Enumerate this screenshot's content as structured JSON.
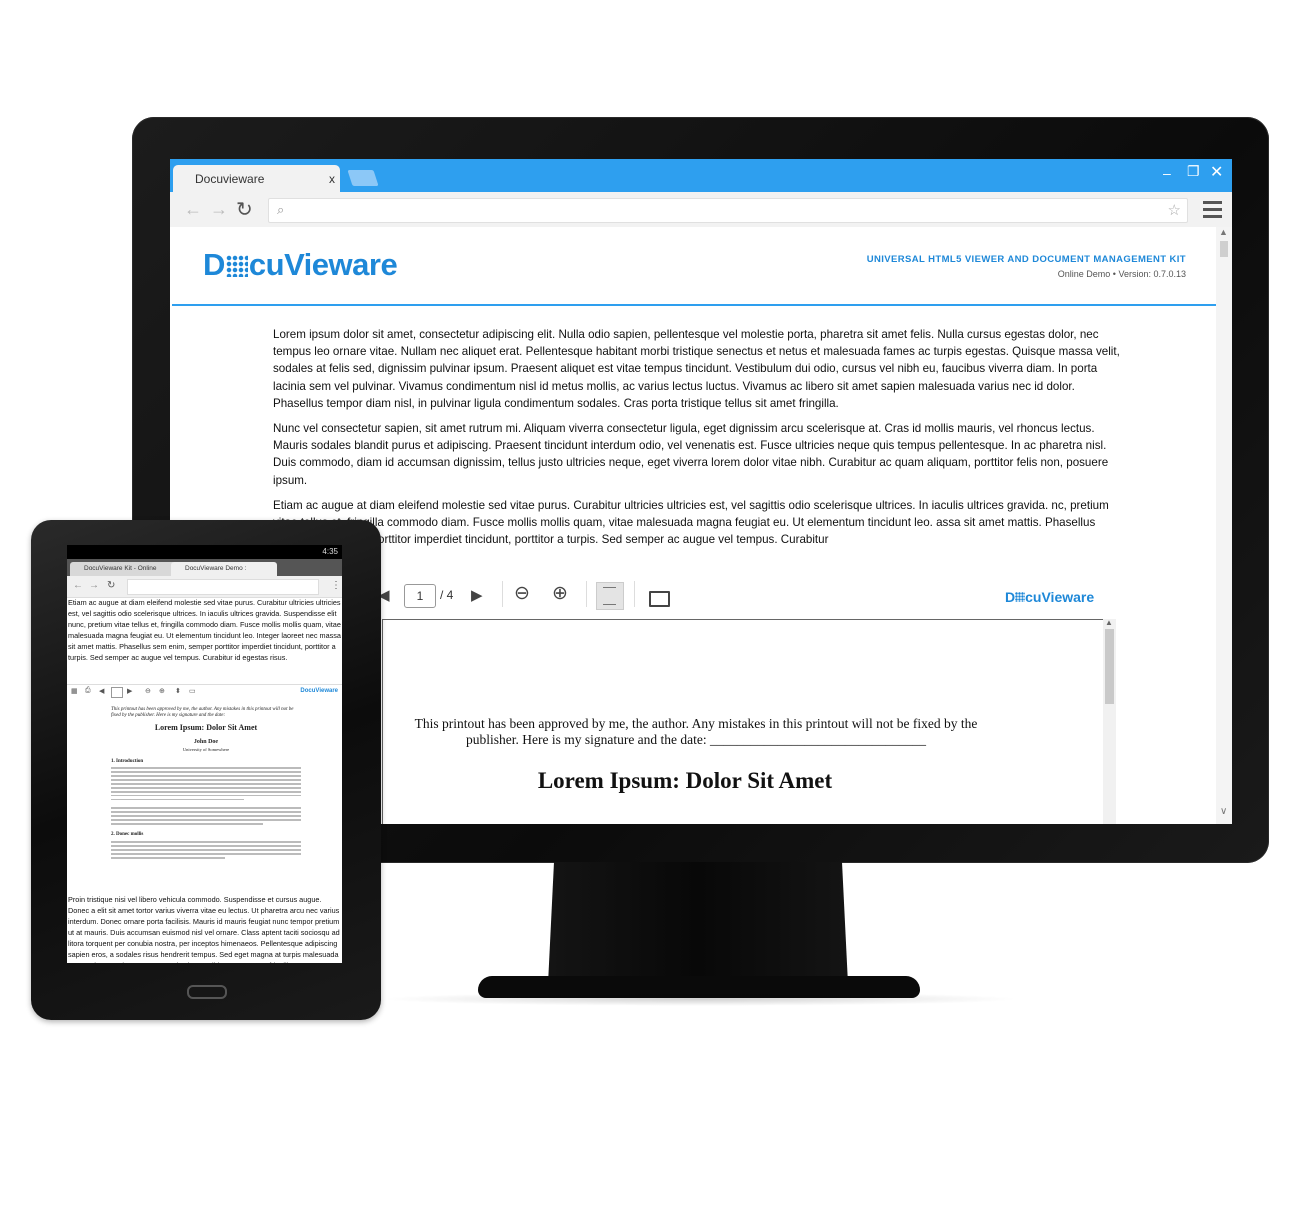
{
  "browser": {
    "tab_title": "Docuvieware",
    "tab_close": "x"
  },
  "header": {
    "brand_prefix": "D",
    "brand_suffix": "cuVieware",
    "tagline": "UNIVERSAL HTML5 VIEWER AND DOCUMENT MANAGEMENT KIT",
    "version": "Online Demo • Version: 0.7.0.13"
  },
  "content": {
    "paragraphs": [
      "Lorem ipsum dolor sit amet, consectetur adipiscing elit. Nulla odio sapien, pellentesque vel molestie porta, pharetra sit amet felis. Nulla cursus egestas dolor, nec tempus leo ornare vitae. Nullam nec aliquet erat. Pellentesque habitant morbi tristique senectus et netus et malesuada fames ac turpis egestas. Quisque massa velit, sodales at felis sed, dignissim pulvinar ipsum. Praesent aliquet est vitae tempus tincidunt. Vestibulum dui odio, cursus vel nibh eu, faucibus viverra diam. In porta lacinia sem vel pulvinar. Vivamus condimentum nisl id metus mollis, ac varius lectus luctus. Vivamus ac libero sit amet sapien malesuada varius nec id dolor. Phasellus tempor diam nisl, in pulvinar ligula condimentum sodales. Cras porta tristique tellus sit amet fringilla.",
      "Nunc vel consectetur sapien, sit amet rutrum mi. Aliquam viverra consectetur ligula, eget dignissim arcu scelerisque at. Cras id mollis mauris, vel rhoncus lectus. Mauris sodales blandit purus et adipiscing. Praesent tincidunt interdum odio, vel venenatis est. Fusce ultricies neque quis tempus pellentesque. In ac pharetra nisl. Duis commodo, diam id accumsan dignissim, tellus justo ultricies neque, eget viverra lorem dolor vitae nibh. Curabitur ac quam aliquam, porttitor felis non, posuere ipsum.",
      "Etiam ac augue at diam eleifend molestie sed vitae purus. Curabitur ultricies ultricies est, vel sagittis odio scelerisque ultrices. In iaculis ultrices gravida. nc, pretium vitae tellus et, fringilla commodo diam. Fusce mollis mollis quam, vitae malesuada magna feugiat eu. Ut elementum tincidunt leo. assa sit amet mattis. Phasellus sem enim, semper porttitor imperdiet tincidunt, porttitor a turpis. Sed semper ac augue vel tempus. Curabitur"
    ]
  },
  "viewer": {
    "page_current": "1",
    "page_total": "/ 4",
    "mini_brand_prefix": "D",
    "mini_brand_suffix": "cuVieware",
    "doc_note": "This printout has been approved by me, the author. Any mistakes in this printout will not be fixed by the publisher. Here is my signature and the date: ________________________________",
    "doc_title": "Lorem Ipsum: Dolor Sit Amet"
  },
  "tablet": {
    "status": "4:35",
    "tab1": "DocuVieware Kit - Online",
    "tab2": "DocuVieware Demo :",
    "top_text": "Etiam ac augue at diam eleifend molestie sed vitae purus. Curabitur ultricies ultricies est, vel sagittis odio scelerisque ultrices. In iaculis ultrices gravida. Suspendisse elit nunc, pretium vitae tellus et, fringilla commodo diam. Fusce mollis mollis quam, vitae malesuada magna feugiat eu. Ut elementum tincidunt leo. Integer laoreet nec massa sit amet mattis. Phasellus sem enim, semper porttitor imperdiet tincidunt, porttitor a turpis. Sed semper ac augue vel tempus. Curabitur id egestas risus.",
    "mini_brand": "DocuVieware",
    "doc_note": "This printout has been approved by me, the author. Any mistakes in this printout will not be fixed by the publisher. Here is my signature and the date:",
    "doc_title": "Lorem Ipsum: Dolor Sit Amet",
    "doc_author": "John Doe",
    "doc_affil": "University of Somewhere",
    "section1": "1. Introduction",
    "section2": "2. Donec mollis",
    "bottom_text": "Proin tristique nisi vel libero vehicula commodo. Suspendisse et cursus augue. Donec a elit sit amet tortor varius viverra vitae eu lectus. Ut pharetra arcu nec varius interdum. Donec ornare porta facilisis. Mauris id mauris feugiat nunc tempor pretium ut at mauris. Duis accumsan euismod nisl vel ornare. Class aptent taciti sociosqu ad litora torquent per conubia nostra, per inceptos himenaeos. Pellentesque adipiscing sapien eros, a sodales risus hendrerit tempus. Sed eget magna at turpis malesuada commodo a non lectus. Donec quis viverra nibh. Cras tempus fringilla magna, nec tempus metus lacinia non. Cras leo tellus, hendrerit nec ipsum id, aliquet congue"
  },
  "colors": {
    "accent": "#2e9fef",
    "brand": "#1e88d8"
  }
}
